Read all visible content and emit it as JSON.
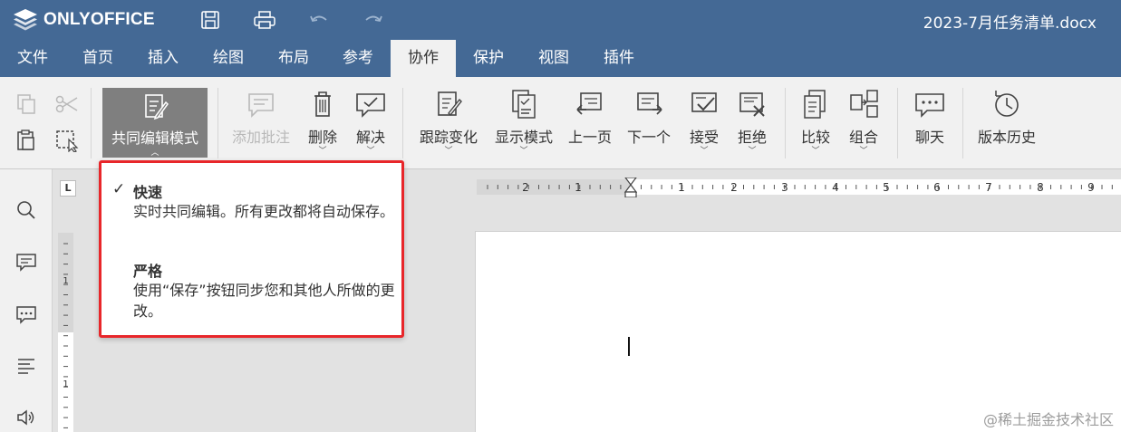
{
  "app": {
    "brand": "ONLYOFFICE",
    "document_title": "2023-7月任务清单.docx"
  },
  "quick_access": [
    "save-icon",
    "print-icon",
    "undo-icon",
    "redo-icon"
  ],
  "tabs": [
    {
      "label": "文件",
      "active": false
    },
    {
      "label": "首页",
      "active": false
    },
    {
      "label": "插入",
      "active": false
    },
    {
      "label": "绘图",
      "active": false
    },
    {
      "label": "布局",
      "active": false
    },
    {
      "label": "参考",
      "active": false
    },
    {
      "label": "协作",
      "active": true
    },
    {
      "label": "保护",
      "active": false
    },
    {
      "label": "视图",
      "active": false
    },
    {
      "label": "插件",
      "active": false
    }
  ],
  "toolbar": {
    "coedit_mode": "共同编辑模式",
    "add_comment": "添加批注",
    "delete": "删除",
    "resolve": "解决",
    "track_changes": "跟踪变化",
    "display_mode": "显示模式",
    "previous": "上一页",
    "next": "下一个",
    "accept": "接受",
    "reject": "拒绝",
    "compare": "比较",
    "combine": "组合",
    "chat": "聊天",
    "version_history": "版本历史"
  },
  "coedit_menu": {
    "items": [
      {
        "title": "快速",
        "description": "实时共同编辑。所有更改都将自动保存。",
        "checked": true
      },
      {
        "title": "严格",
        "description": "使用“保存”按钮同步您和其他人所做的更改。",
        "checked": false
      }
    ]
  },
  "ruler": {
    "tab_marker": "L",
    "h_numbers": [
      "2",
      "1",
      "1",
      "2",
      "3",
      "4",
      "5",
      "6",
      "7",
      "8",
      "9"
    ],
    "v_numbers": [
      "1",
      "1"
    ]
  },
  "watermark": "@稀土掘金技术社区",
  "colors": {
    "header": "#446995",
    "toolbar": "#f1f1f1",
    "active_button": "#7f7f7f",
    "highlight_border": "#e8262a"
  }
}
